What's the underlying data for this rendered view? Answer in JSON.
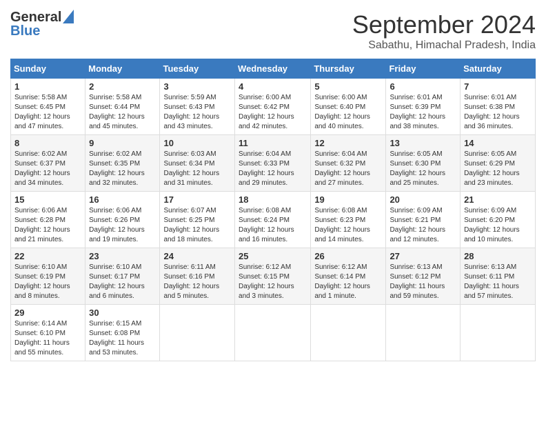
{
  "header": {
    "logo_general": "General",
    "logo_blue": "Blue",
    "month_title": "September 2024",
    "subtitle": "Sabathu, Himachal Pradesh, India"
  },
  "weekdays": [
    "Sunday",
    "Monday",
    "Tuesday",
    "Wednesday",
    "Thursday",
    "Friday",
    "Saturday"
  ],
  "weeks": [
    [
      {
        "day": "1",
        "info": "Sunrise: 5:58 AM\nSunset: 6:45 PM\nDaylight: 12 hours\nand 47 minutes."
      },
      {
        "day": "2",
        "info": "Sunrise: 5:58 AM\nSunset: 6:44 PM\nDaylight: 12 hours\nand 45 minutes."
      },
      {
        "day": "3",
        "info": "Sunrise: 5:59 AM\nSunset: 6:43 PM\nDaylight: 12 hours\nand 43 minutes."
      },
      {
        "day": "4",
        "info": "Sunrise: 6:00 AM\nSunset: 6:42 PM\nDaylight: 12 hours\nand 42 minutes."
      },
      {
        "day": "5",
        "info": "Sunrise: 6:00 AM\nSunset: 6:40 PM\nDaylight: 12 hours\nand 40 minutes."
      },
      {
        "day": "6",
        "info": "Sunrise: 6:01 AM\nSunset: 6:39 PM\nDaylight: 12 hours\nand 38 minutes."
      },
      {
        "day": "7",
        "info": "Sunrise: 6:01 AM\nSunset: 6:38 PM\nDaylight: 12 hours\nand 36 minutes."
      }
    ],
    [
      {
        "day": "8",
        "info": "Sunrise: 6:02 AM\nSunset: 6:37 PM\nDaylight: 12 hours\nand 34 minutes."
      },
      {
        "day": "9",
        "info": "Sunrise: 6:02 AM\nSunset: 6:35 PM\nDaylight: 12 hours\nand 32 minutes."
      },
      {
        "day": "10",
        "info": "Sunrise: 6:03 AM\nSunset: 6:34 PM\nDaylight: 12 hours\nand 31 minutes."
      },
      {
        "day": "11",
        "info": "Sunrise: 6:04 AM\nSunset: 6:33 PM\nDaylight: 12 hours\nand 29 minutes."
      },
      {
        "day": "12",
        "info": "Sunrise: 6:04 AM\nSunset: 6:32 PM\nDaylight: 12 hours\nand 27 minutes."
      },
      {
        "day": "13",
        "info": "Sunrise: 6:05 AM\nSunset: 6:30 PM\nDaylight: 12 hours\nand 25 minutes."
      },
      {
        "day": "14",
        "info": "Sunrise: 6:05 AM\nSunset: 6:29 PM\nDaylight: 12 hours\nand 23 minutes."
      }
    ],
    [
      {
        "day": "15",
        "info": "Sunrise: 6:06 AM\nSunset: 6:28 PM\nDaylight: 12 hours\nand 21 minutes."
      },
      {
        "day": "16",
        "info": "Sunrise: 6:06 AM\nSunset: 6:26 PM\nDaylight: 12 hours\nand 19 minutes."
      },
      {
        "day": "17",
        "info": "Sunrise: 6:07 AM\nSunset: 6:25 PM\nDaylight: 12 hours\nand 18 minutes."
      },
      {
        "day": "18",
        "info": "Sunrise: 6:08 AM\nSunset: 6:24 PM\nDaylight: 12 hours\nand 16 minutes."
      },
      {
        "day": "19",
        "info": "Sunrise: 6:08 AM\nSunset: 6:23 PM\nDaylight: 12 hours\nand 14 minutes."
      },
      {
        "day": "20",
        "info": "Sunrise: 6:09 AM\nSunset: 6:21 PM\nDaylight: 12 hours\nand 12 minutes."
      },
      {
        "day": "21",
        "info": "Sunrise: 6:09 AM\nSunset: 6:20 PM\nDaylight: 12 hours\nand 10 minutes."
      }
    ],
    [
      {
        "day": "22",
        "info": "Sunrise: 6:10 AM\nSunset: 6:19 PM\nDaylight: 12 hours\nand 8 minutes."
      },
      {
        "day": "23",
        "info": "Sunrise: 6:10 AM\nSunset: 6:17 PM\nDaylight: 12 hours\nand 6 minutes."
      },
      {
        "day": "24",
        "info": "Sunrise: 6:11 AM\nSunset: 6:16 PM\nDaylight: 12 hours\nand 5 minutes."
      },
      {
        "day": "25",
        "info": "Sunrise: 6:12 AM\nSunset: 6:15 PM\nDaylight: 12 hours\nand 3 minutes."
      },
      {
        "day": "26",
        "info": "Sunrise: 6:12 AM\nSunset: 6:14 PM\nDaylight: 12 hours\nand 1 minute."
      },
      {
        "day": "27",
        "info": "Sunrise: 6:13 AM\nSunset: 6:12 PM\nDaylight: 11 hours\nand 59 minutes."
      },
      {
        "day": "28",
        "info": "Sunrise: 6:13 AM\nSunset: 6:11 PM\nDaylight: 11 hours\nand 57 minutes."
      }
    ],
    [
      {
        "day": "29",
        "info": "Sunrise: 6:14 AM\nSunset: 6:10 PM\nDaylight: 11 hours\nand 55 minutes."
      },
      {
        "day": "30",
        "info": "Sunrise: 6:15 AM\nSunset: 6:08 PM\nDaylight: 11 hours\nand 53 minutes."
      },
      {
        "day": "",
        "info": ""
      },
      {
        "day": "",
        "info": ""
      },
      {
        "day": "",
        "info": ""
      },
      {
        "day": "",
        "info": ""
      },
      {
        "day": "",
        "info": ""
      }
    ]
  ]
}
